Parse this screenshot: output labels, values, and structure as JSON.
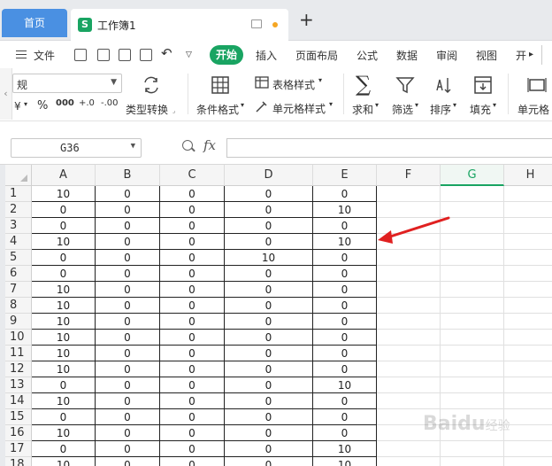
{
  "tabs": {
    "home_label": "首页",
    "workbook_icon": "S",
    "workbook_label": "工作簿1"
  },
  "menu": {
    "file_label": "文件",
    "items": [
      "开始",
      "插入",
      "页面布局",
      "公式",
      "数据",
      "审阅",
      "视图",
      "开"
    ],
    "active_index": 0
  },
  "ribbon": {
    "number_format_value": "规",
    "percent_symbol": "%",
    "thousands_symbol": "000",
    "inc_decimal": "+.0",
    "dec_decimal": "-.00",
    "currency_symbol": "¥",
    "convert_label": "类型转换",
    "cond_format_label": "条件格式",
    "table_style_label": "表格样式",
    "cell_style_label": "单元格样式",
    "sum_label": "求和",
    "filter_label": "筛选",
    "sort_label": "排序",
    "fill_label": "填充",
    "cell_label": "单元格"
  },
  "formula_bar": {
    "name_box": "G36",
    "fx_label": "fx",
    "formula": ""
  },
  "sheet": {
    "columns": [
      "A",
      "B",
      "C",
      "D",
      "E",
      "F",
      "G",
      "H"
    ],
    "selected_column": "G",
    "rows": [
      [
        "10",
        "0",
        "0",
        "0",
        "0"
      ],
      [
        "0",
        "0",
        "0",
        "0",
        "10"
      ],
      [
        "0",
        "0",
        "0",
        "0",
        "0"
      ],
      [
        "10",
        "0",
        "0",
        "0",
        "10"
      ],
      [
        "0",
        "0",
        "0",
        "10",
        "0"
      ],
      [
        "0",
        "0",
        "0",
        "0",
        "0"
      ],
      [
        "10",
        "0",
        "0",
        "0",
        "0"
      ],
      [
        "10",
        "0",
        "0",
        "0",
        "0"
      ],
      [
        "10",
        "0",
        "0",
        "0",
        "0"
      ],
      [
        "10",
        "0",
        "0",
        "0",
        "0"
      ],
      [
        "10",
        "0",
        "0",
        "0",
        "0"
      ],
      [
        "10",
        "0",
        "0",
        "0",
        "0"
      ],
      [
        "0",
        "0",
        "0",
        "0",
        "10"
      ],
      [
        "10",
        "0",
        "0",
        "0",
        "0"
      ],
      [
        "0",
        "0",
        "0",
        "0",
        "0"
      ],
      [
        "10",
        "0",
        "0",
        "0",
        "0"
      ],
      [
        "0",
        "0",
        "0",
        "0",
        "10"
      ],
      [
        "10",
        "0",
        "0",
        "0",
        "10"
      ]
    ]
  },
  "annotation": {
    "arrow_color": "#e02020"
  },
  "colors": {
    "accent": "#19a462",
    "home_tab": "#4a90e2"
  },
  "watermark": {
    "text": "Baidu",
    "sub": "经验"
  }
}
